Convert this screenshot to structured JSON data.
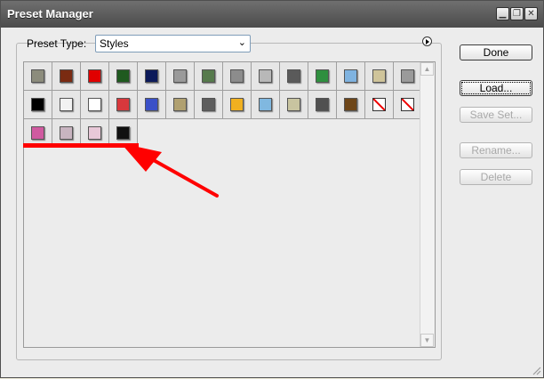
{
  "window": {
    "title": "Preset Manager",
    "controls": [
      "minimize",
      "restore",
      "close"
    ]
  },
  "preset": {
    "label": "Preset Type:",
    "selected": "Styles"
  },
  "buttons": {
    "done": "Done",
    "load": "Load...",
    "save_set": "Save Set...",
    "rename": "Rename...",
    "delete": "Delete"
  },
  "swatches": [
    {
      "color": "#8c8c7c",
      "icon": "stone-style-icon"
    },
    {
      "color": "#7a2b12",
      "icon": "brick-style-icon"
    },
    {
      "color": "#e00000",
      "icon": "red-style-icon"
    },
    {
      "color": "#1f5a1f",
      "icon": "green-style-icon"
    },
    {
      "color": "#0c1a5a",
      "icon": "navy-style-icon"
    },
    {
      "color": "#9a9a9a",
      "icon": "texture-style-icon"
    },
    {
      "color": "#567a4c",
      "icon": "moss-style-icon"
    },
    {
      "color": "#8c8c8c",
      "icon": "gray-style-icon"
    },
    {
      "color": "#b8b8b8",
      "icon": "barcode-style-icon"
    },
    {
      "color": "#5a5a5a",
      "icon": "dark-gray-style-icon"
    },
    {
      "color": "#2f8f3f",
      "icon": "green-glass-style-icon"
    },
    {
      "color": "#7fb3e0",
      "icon": "blue-glass-style-icon"
    },
    {
      "color": "#cfc49a",
      "icon": "sand-style-icon"
    },
    {
      "color": "#9a9a9a",
      "icon": "bevel-style-icon"
    },
    {
      "color": "#000000",
      "icon": "black-style-icon"
    },
    {
      "color": "#f2f2f2",
      "icon": "crackle-style-icon"
    },
    {
      "color": "#ffffff",
      "icon": "white-style-icon"
    },
    {
      "color": "#d8383c",
      "icon": "red-texture-style-icon"
    },
    {
      "color": "#3a50c8",
      "icon": "blue-style-icon"
    },
    {
      "color": "#b0a070",
      "icon": "burlap-style-icon"
    },
    {
      "color": "#5e5e5e",
      "icon": "slate-style-icon"
    },
    {
      "color": "#f0b020",
      "icon": "gold-style-icon"
    },
    {
      "color": "#80b8e0",
      "icon": "light-blue-style-icon"
    },
    {
      "color": "#c8c4a0",
      "icon": "parchment-style-icon"
    },
    {
      "color": "#505050",
      "icon": "checker-style-icon"
    },
    {
      "color": "#6e4618",
      "icon": "wood-style-icon"
    },
    {
      "color": "none",
      "icon": "no-style-icon"
    },
    {
      "color": "none",
      "icon": "no-style-icon"
    },
    {
      "color": "#d05aa0",
      "icon": "pink-style-icon"
    },
    {
      "color": "#c8b4c0",
      "icon": "pink-mauve-style-icon"
    },
    {
      "color": "#e8c8d8",
      "icon": "pink-ring-style-icon"
    },
    {
      "color": "#111111",
      "icon": "black-symbol-style-icon"
    }
  ],
  "accent_colors": {
    "annotation_red": "#ff0000"
  }
}
